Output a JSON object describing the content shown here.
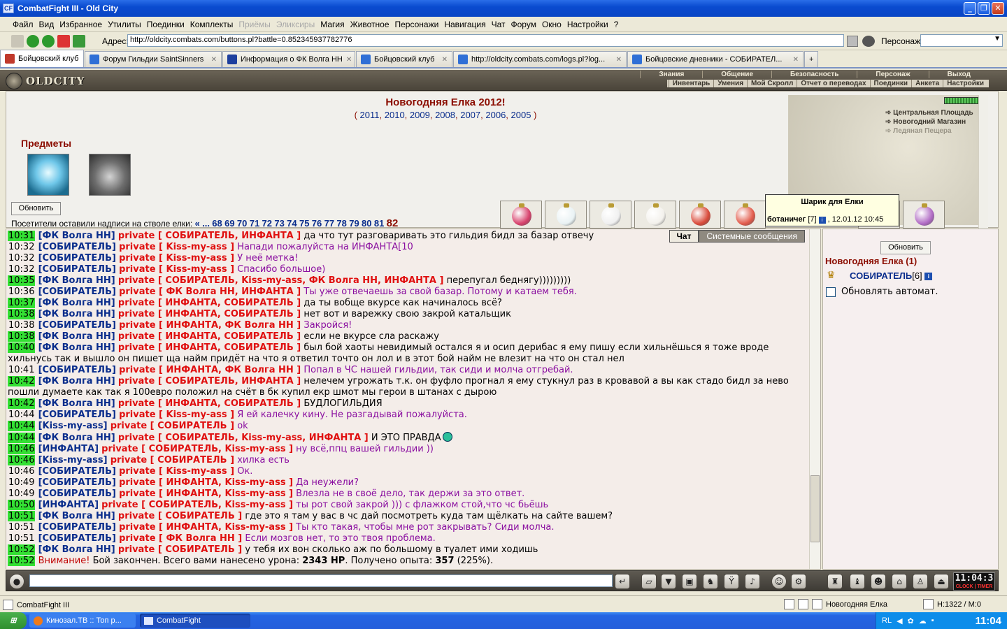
{
  "window": {
    "title": "CombatFight III - Old City",
    "icon_text": "CF"
  },
  "menu": [
    {
      "label": "Файл",
      "disabled": false
    },
    {
      "label": "Вид",
      "disabled": false
    },
    {
      "label": "Избранное",
      "disabled": false
    },
    {
      "label": "Утилиты",
      "disabled": false
    },
    {
      "label": "Поединки",
      "disabled": false
    },
    {
      "label": "Комплекты",
      "disabled": false
    },
    {
      "label": "Приёмы",
      "disabled": true
    },
    {
      "label": "Эликсиры",
      "disabled": true
    },
    {
      "label": "Магия",
      "disabled": false
    },
    {
      "label": "Животное",
      "disabled": false
    },
    {
      "label": "Персонажи",
      "disabled": false
    },
    {
      "label": "Навигация",
      "disabled": false
    },
    {
      "label": "Чат",
      "disabled": false
    },
    {
      "label": "Форум",
      "disabled": false
    },
    {
      "label": "Окно",
      "disabled": false
    },
    {
      "label": "Настройки",
      "disabled": false
    },
    {
      "label": "?",
      "disabled": false
    }
  ],
  "address": {
    "label": "Адрес:",
    "url": "http://oldcity.combats.com/buttons.pl?battle=0.852345937782776",
    "persona_label": "Персонаж:"
  },
  "tabs": [
    {
      "label": "Бойцовский клуб",
      "active": true,
      "icon_color": "#c0392b"
    },
    {
      "label": "Форум Гильдии SaintSinners",
      "active": false,
      "icon_color": "#2f6fd6"
    },
    {
      "label": "Информация о ФК Волга НН",
      "active": false,
      "icon_color": "#1d3f9e"
    },
    {
      "label": "Бойцовский клуб",
      "active": false,
      "icon_color": "#2f6fd6"
    },
    {
      "label": "http://oldcity.combats.com/logs.pl?log...",
      "active": false,
      "icon_color": "#2f6fd6"
    },
    {
      "label": "Бойцовские дневники - СОБИРАТЕЛ...",
      "active": false,
      "icon_color": "#2f6fd6"
    }
  ],
  "game_header": {
    "logo": "OLDCITY",
    "nav_top": [
      "Знания",
      "Общение",
      "Безопасность",
      "Персонаж",
      "Выход"
    ],
    "nav_bottom": [
      "Инвентарь",
      "Умения",
      "Мой Скролл",
      "Отчет о переводах",
      "Поединки",
      "Анкета",
      "Настройки"
    ]
  },
  "event": {
    "title": "Новогодняя Елка 2012!",
    "years": [
      "2011",
      "2010",
      "2009",
      "2008",
      "2007",
      "2006",
      "2005"
    ],
    "items_title": "Предметы",
    "refresh": "Обновить",
    "visitors_text": "Посетители оставили надписи на стволе елки:",
    "pages_prefix": [
      "«",
      "..."
    ],
    "pages": [
      "68",
      "69",
      "70",
      "71",
      "72",
      "73",
      "74",
      "75",
      "76",
      "77",
      "78",
      "79",
      "80",
      "81"
    ],
    "current_page": "82"
  },
  "map": {
    "links": [
      "Центральная Площадь",
      "Новогодний Магазин",
      "Ледяная Пещера"
    ]
  },
  "ornaments": [
    {
      "color": "#d7416c"
    },
    {
      "color": "#e9f2f4"
    },
    {
      "color": "#f0f0f0"
    },
    {
      "color": "#f3f1ec"
    },
    {
      "color": "#d94a3a"
    },
    {
      "color": "#e25a4a"
    },
    {
      "color": "#8ac8e6"
    },
    {
      "color": "#b06ac4"
    }
  ],
  "tooltip": {
    "title": "Шарик для Елки",
    "author": "ботаничег",
    "level": "[7]",
    "date": ", 12.01.12 10:45"
  },
  "chat_tabs": [
    "Чат",
    "Системные сообщения"
  ],
  "chat": [
    {
      "time": "10:31",
      "hl": true,
      "name": "[ФК Волга НН]",
      "priv": "private [ СОБИРАТЕЛЬ, ИНФАНТА ]",
      "text": "да что тут разговаривать это гильдия бидл за базар отвечу",
      "purple": false
    },
    {
      "time": "10:32",
      "hl": false,
      "name": "[СОБИРАТЕЛЬ]",
      "priv": "private [ Kiss-my-ass ]",
      "text": "Напади пожалуйста на ИНФАНТА[10",
      "purple": true
    },
    {
      "time": "10:32",
      "hl": false,
      "name": "[СОБИРАТЕЛЬ]",
      "priv": "private [ Kiss-my-ass ]",
      "text": "У неё метка!",
      "purple": true
    },
    {
      "time": "10:32",
      "hl": false,
      "name": "[СОБИРАТЕЛЬ]",
      "priv": "private [ Kiss-my-ass ]",
      "text": "Спасибо большое)",
      "purple": true
    },
    {
      "time": "10:35",
      "hl": true,
      "name": "[ФК Волга НН]",
      "priv": "private [ СОБИРАТЕЛЬ, Kiss-my-ass, ФК Волга НН, ИНФАНТА ]",
      "text": "перепугал беднягу)))))))))",
      "purple": false
    },
    {
      "time": "10:36",
      "hl": false,
      "name": "[СОБИРАТЕЛЬ]",
      "priv": "private [ ФК Волга НН, ИНФАНТА ]",
      "text": "Ты уже отвечаешь за свой базар. Потому и катаем тебя.",
      "purple": true
    },
    {
      "time": "10:37",
      "hl": true,
      "name": "[ФК Волга НН]",
      "priv": "private [ ИНФАНТА, СОБИРАТЕЛЬ ]",
      "text": "да ты вобще вкурсе как начиналось всё?",
      "purple": false
    },
    {
      "time": "10:38",
      "hl": true,
      "name": "[ФК Волга НН]",
      "priv": "private [ ИНФАНТА, СОБИРАТЕЛЬ ]",
      "text": "нет вот и варежку свою закрой катальщик",
      "purple": false
    },
    {
      "time": "10:38",
      "hl": false,
      "name": "[СОБИРАТЕЛЬ]",
      "priv": "private [ ИНФАНТА, ФК Волга НН ]",
      "text": "Закройся!",
      "purple": true
    },
    {
      "time": "10:38",
      "hl": true,
      "name": "[ФК Волга НН]",
      "priv": "private [ ИНФАНТА, СОБИРАТЕЛЬ ]",
      "text": "если не вкурсе сла раскажу",
      "purple": false
    },
    {
      "time": "10:40",
      "hl": true,
      "name": "[ФК Волга НН]",
      "priv": "private [ ИНФАНТА, СОБИРАТЕЛЬ ]",
      "text": "был бой хаоты невидимый остался я и осип дерибас я ему пишу если хильнёшься я тоже вроде хильнусь так и вышло он пишет ща найм придёт на что я ответил точто он лол и в этот бой найм не влезит на что он стал нел",
      "purple": false
    },
    {
      "time": "10:41",
      "hl": false,
      "name": "[СОБИРАТЕЛЬ]",
      "priv": "private [ ИНФАНТА, ФК Волга НН ]",
      "text": "Попал в ЧС нашей гильдии, так сиди и молча отгребай.",
      "purple": true
    },
    {
      "time": "10:42",
      "hl": true,
      "name": "[ФК Волга НН]",
      "priv": "private [ СОБИРАТЕЛЬ, ИНФАНТА ]",
      "text": "нелечем угрожать т.к. он фуфло прогнал я ему стукнул раз в кровавой а вы как стадо бидл за нево пошли думаете как так я 100евро положил на счёт в бк купил екр шмот мы герои в штанах с дырою",
      "purple": false
    },
    {
      "time": "10:42",
      "hl": true,
      "name": "[ФК Волга НН]",
      "priv": "private [ ИНФАНТА, СОБИРАТЕЛЬ ]",
      "text": "БУДЛОГИЛЬДИЯ",
      "purple": false
    },
    {
      "time": "10:44",
      "hl": false,
      "name": "[СОБИРАТЕЛЬ]",
      "priv": "private [ Kiss-my-ass ]",
      "text": "Я ей калечку кину. Не разгадывай пожалуйста.",
      "purple": true
    },
    {
      "time": "10:44",
      "hl": true,
      "name": "[Kiss-my-ass]",
      "priv": "private [ СОБИРАТЕЛЬ ]",
      "text": "ok",
      "purple": true
    },
    {
      "time": "10:44",
      "hl": true,
      "name": "[ФК Волга НН]",
      "priv": "private [ СОБИРАТЕЛЬ, Kiss-my-ass, ИНФАНТА ]",
      "text": "И ЭТО ПРАВДА",
      "purple": false,
      "smiley": true
    },
    {
      "time": "10:46",
      "hl": true,
      "name": "[ИНФАНТА]",
      "priv": "private [ СОБИРАТЕЛЬ, Kiss-my-ass ]",
      "text": "ну всё,ппц вашей гильдии ))",
      "purple": true
    },
    {
      "time": "10:46",
      "hl": true,
      "name": "[Kiss-my-ass]",
      "priv": "private [ СОБИРАТЕЛЬ ]",
      "text": "хилка есть",
      "purple": true
    },
    {
      "time": "10:46",
      "hl": false,
      "name": "[СОБИРАТЕЛЬ]",
      "priv": "private [ Kiss-my-ass ]",
      "text": "Ок.",
      "purple": true
    },
    {
      "time": "10:49",
      "hl": false,
      "name": "[СОБИРАТЕЛЬ]",
      "priv": "private [ ИНФАНТА, Kiss-my-ass ]",
      "text": "Да неужели?",
      "purple": true
    },
    {
      "time": "10:49",
      "hl": false,
      "name": "[СОБИРАТЕЛЬ]",
      "priv": "private [ ИНФАНТА, Kiss-my-ass ]",
      "text": "Влезла не в своё дело, так держи за это ответ.",
      "purple": true
    },
    {
      "time": "10:50",
      "hl": true,
      "name": "[ИНФАНТА]",
      "priv": "private [ СОБИРАТЕЛЬ, Kiss-my-ass ]",
      "text": "ты рот свой закрой ))) с флажком стой,что чс бьёшь",
      "purple": true
    },
    {
      "time": "10:51",
      "hl": true,
      "name": "[ФК Волга НН]",
      "priv": "private [ СОБИРАТЕЛЬ ]",
      "text": "где это я там у вас в чс дай посмотреть куда там щёлкать на сайте вашем?",
      "purple": false
    },
    {
      "time": "10:51",
      "hl": false,
      "name": "[СОБИРАТЕЛЬ]",
      "priv": "private [ ИНФАНТА, Kiss-my-ass ]",
      "text": "Ты кто такая, чтобы мне рот закрывать? Сиди молча.",
      "purple": true
    },
    {
      "time": "10:51",
      "hl": false,
      "name": "[СОБИРАТЕЛЬ]",
      "priv": "private [ ФК Волга НН ]",
      "text": "Если мозгов нет, то это твоя проблема.",
      "purple": true
    },
    {
      "time": "10:52",
      "hl": true,
      "name": "[ФК Волга НН]",
      "priv": "private [ СОБИРАТЕЛЬ ]",
      "text": "у тебя их вон сколько аж по большому в туалет ими ходишь",
      "purple": false
    }
  ],
  "system_line": {
    "time": "10:52",
    "warn": "Внимание!",
    "text1": "Бой закончен. Всего вами нанесено урона:",
    "hp": "2343 HP",
    "text2": ". Получено опыта:",
    "exp": "357",
    "text3": "(225%)."
  },
  "room": {
    "refresh": "Обновить",
    "title": "Новогодняя Елка (1)",
    "member": "СОБИРАТЕЛЬ",
    "member_level": "[6]",
    "auto_label": "Обновлять автомат."
  },
  "clock": {
    "time": "11:04:3",
    "label": "CLOCK",
    "timer_label": "TIMER"
  },
  "status": {
    "app": "CombatFight III",
    "location": "Новогодняя Елка",
    "hp": "H:1322 / M:0"
  },
  "taskbar": {
    "items": [
      "Кинозал.ТВ :: Топ р...",
      "CombatFight"
    ],
    "lang": "RL",
    "time": "11:04"
  }
}
